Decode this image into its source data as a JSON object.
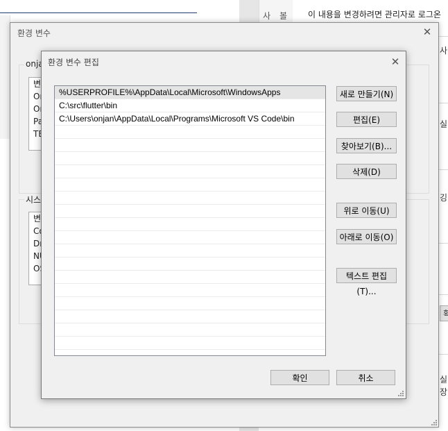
{
  "background": {
    "tab_labels": [
      "사",
      "볼"
    ],
    "right_text": "이 내용을 변경하려면 관리자로 로그온",
    "right_fragments": [
      "사",
      "실",
      "깅",
      "확",
      "실",
      "장"
    ]
  },
  "outer_dialog": {
    "title": "환경 변수",
    "user_group_label": "onjan",
    "user_list_header": "변",
    "user_list_items": [
      "On",
      "On",
      "Pa",
      "TE"
    ],
    "system_group_label": "시스",
    "system_list_header": "변",
    "system_list_items": [
      "Co",
      "Dr",
      "NU",
      "OS"
    ]
  },
  "edit_dialog": {
    "title": "환경 변수 편집",
    "paths": [
      "%USERPROFILE%\\AppData\\Local\\Microsoft\\WindowsApps",
      "C:\\src\\flutter\\bin",
      "C:\\Users\\onjan\\AppData\\Local\\Programs\\Microsoft VS Code\\bin"
    ],
    "buttons": {
      "new": "새로 만들기(N)",
      "edit": "편집(E)",
      "browse": "찾아보기(B)...",
      "delete": "삭제(D)",
      "move_up": "위로 이동(U)",
      "move_down": "아래로 이동(O)",
      "edit_text": "텍스트 편집(T)...",
      "ok": "확인",
      "cancel": "취소"
    }
  }
}
